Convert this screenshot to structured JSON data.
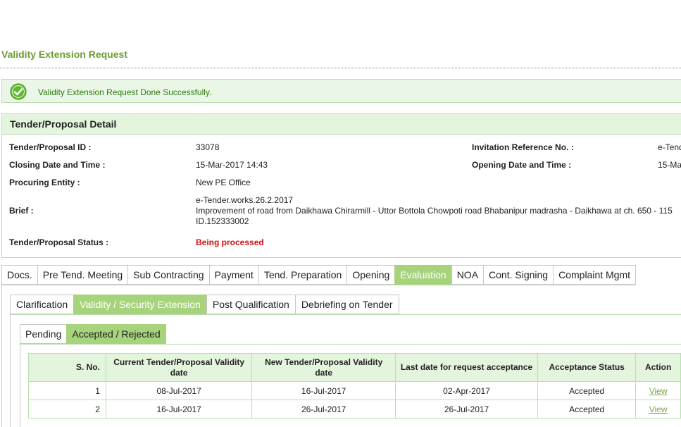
{
  "page_title": "Validity Extension Request",
  "success_message": "Validity Extension Request Done Successfully.",
  "detail": {
    "header": "Tender/Proposal Detail",
    "tender_id_label": "Tender/Proposal ID :",
    "tender_id_value": "33078",
    "invitation_ref_label": "Invitation Reference No. :",
    "invitation_ref_value": "e-Tend",
    "closing_label": "Closing Date and Time :",
    "closing_value": "15-Mar-2017 14:43",
    "opening_label": "Opening Date and Time :",
    "opening_value": "15-Ma",
    "procuring_label": "Procuring Entity :",
    "procuring_value": "New PE Office",
    "brief_label": "Brief :",
    "brief_line1": "e-Tender.works.26.2.2017",
    "brief_line2": "Improvement of road from Daikhawa Chirarmill - Uttor Bottola Chowpoti road Bhabanipur madrasha - Daikhawa at ch. 650 - 115",
    "brief_line3": "ID.152333002",
    "status_label": "Tender/Proposal Status :",
    "status_value": "Being processed"
  },
  "main_tabs": [
    {
      "label": "Docs.",
      "active": false
    },
    {
      "label": "Pre Tend. Meeting",
      "active": false
    },
    {
      "label": "Sub Contracting",
      "active": false
    },
    {
      "label": "Payment",
      "active": false
    },
    {
      "label": "Tend. Preparation",
      "active": false
    },
    {
      "label": "Opening",
      "active": false
    },
    {
      "label": "Evaluation",
      "active": true
    },
    {
      "label": "NOA",
      "active": false
    },
    {
      "label": "Cont. Signing",
      "active": false
    },
    {
      "label": "Complaint Mgmt",
      "active": false
    }
  ],
  "sub_tabs": [
    {
      "label": "Clarification",
      "active": false
    },
    {
      "label": "Validity / Security Extension",
      "active": true
    },
    {
      "label": "Post Qualification",
      "active": false
    },
    {
      "label": "Debriefing on Tender",
      "active": false
    }
  ],
  "state_tabs": [
    {
      "label": "Pending",
      "active": false
    },
    {
      "label": "Accepted / Rejected",
      "active": true
    }
  ],
  "table": {
    "headers": [
      "S. No.",
      "Current Tender/Proposal Validity date",
      "New Tender/Proposal Validity date",
      "Last date for request acceptance",
      "Acceptance Status",
      "Action"
    ],
    "rows": [
      {
        "sno": "1",
        "current": "08-Jul-2017",
        "new": "16-Jul-2017",
        "last": "02-Apr-2017",
        "status": "Accepted",
        "action": "View"
      },
      {
        "sno": "2",
        "current": "16-Jul-2017",
        "new": "26-Jul-2017",
        "last": "26-Jul-2017",
        "status": "Accepted",
        "action": "View"
      }
    ]
  },
  "colors": {
    "accent": "#a6d37c",
    "title_green": "#6b9c2f",
    "status_red": "#cc1111",
    "header_bg": "#e4f5de"
  }
}
